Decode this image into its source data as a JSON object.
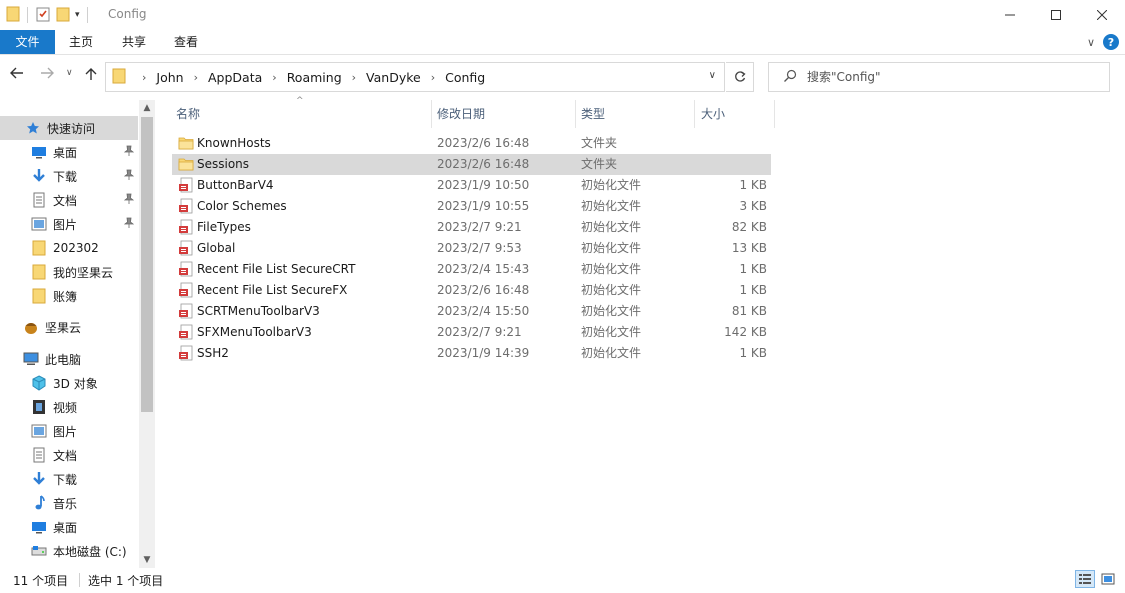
{
  "window": {
    "title": "Config"
  },
  "ribbon": {
    "tabs": [
      "文件",
      "主页",
      "共享",
      "查看"
    ]
  },
  "address": {
    "crumbs": [
      "John",
      "AppData",
      "Roaming",
      "VanDyke",
      "Config"
    ]
  },
  "search": {
    "placeholder": "搜索\"Config\""
  },
  "nav": {
    "quick_access": "快速访问",
    "quick_items": [
      "桌面",
      "下载",
      "文档",
      "图片",
      "202302",
      "我的坚果云",
      "账簿"
    ],
    "nutstore": "坚果云",
    "this_pc": "此电脑",
    "pc_items": [
      "3D 对象",
      "视频",
      "图片",
      "文档",
      "下载",
      "音乐",
      "桌面",
      "本地磁盘 (C:)"
    ]
  },
  "columns": {
    "name": "名称",
    "date": "修改日期",
    "type": "类型",
    "size": "大小"
  },
  "files": [
    {
      "name": "KnownHosts",
      "date": "2023/2/6 16:48",
      "type": "文件夹",
      "size": "",
      "kind": "folder"
    },
    {
      "name": "Sessions",
      "date": "2023/2/6 16:48",
      "type": "文件夹",
      "size": "",
      "kind": "folder"
    },
    {
      "name": "ButtonBarV4",
      "date": "2023/1/9 10:50",
      "type": "初始化文件",
      "size": "1 KB",
      "kind": "ini"
    },
    {
      "name": "Color Schemes",
      "date": "2023/1/9 10:55",
      "type": "初始化文件",
      "size": "3 KB",
      "kind": "ini"
    },
    {
      "name": "FileTypes",
      "date": "2023/2/7 9:21",
      "type": "初始化文件",
      "size": "82 KB",
      "kind": "ini"
    },
    {
      "name": "Global",
      "date": "2023/2/7 9:53",
      "type": "初始化文件",
      "size": "13 KB",
      "kind": "ini"
    },
    {
      "name": "Recent File List SecureCRT",
      "date": "2023/2/4 15:43",
      "type": "初始化文件",
      "size": "1 KB",
      "kind": "ini"
    },
    {
      "name": "Recent File List SecureFX",
      "date": "2023/2/6 16:48",
      "type": "初始化文件",
      "size": "1 KB",
      "kind": "ini"
    },
    {
      "name": "SCRTMenuToolbarV3",
      "date": "2023/2/4 15:50",
      "type": "初始化文件",
      "size": "81 KB",
      "kind": "ini"
    },
    {
      "name": "SFXMenuToolbarV3",
      "date": "2023/2/7 9:21",
      "type": "初始化文件",
      "size": "142 KB",
      "kind": "ini"
    },
    {
      "name": "SSH2",
      "date": "2023/1/9 14:39",
      "type": "初始化文件",
      "size": "1 KB",
      "kind": "ini"
    }
  ],
  "status": {
    "count": "11 个项目",
    "selected": "选中 1 个项目"
  },
  "colors": {
    "accent": "#1979ca",
    "selection": "#d9d9d9",
    "folder": "#f8d775"
  }
}
